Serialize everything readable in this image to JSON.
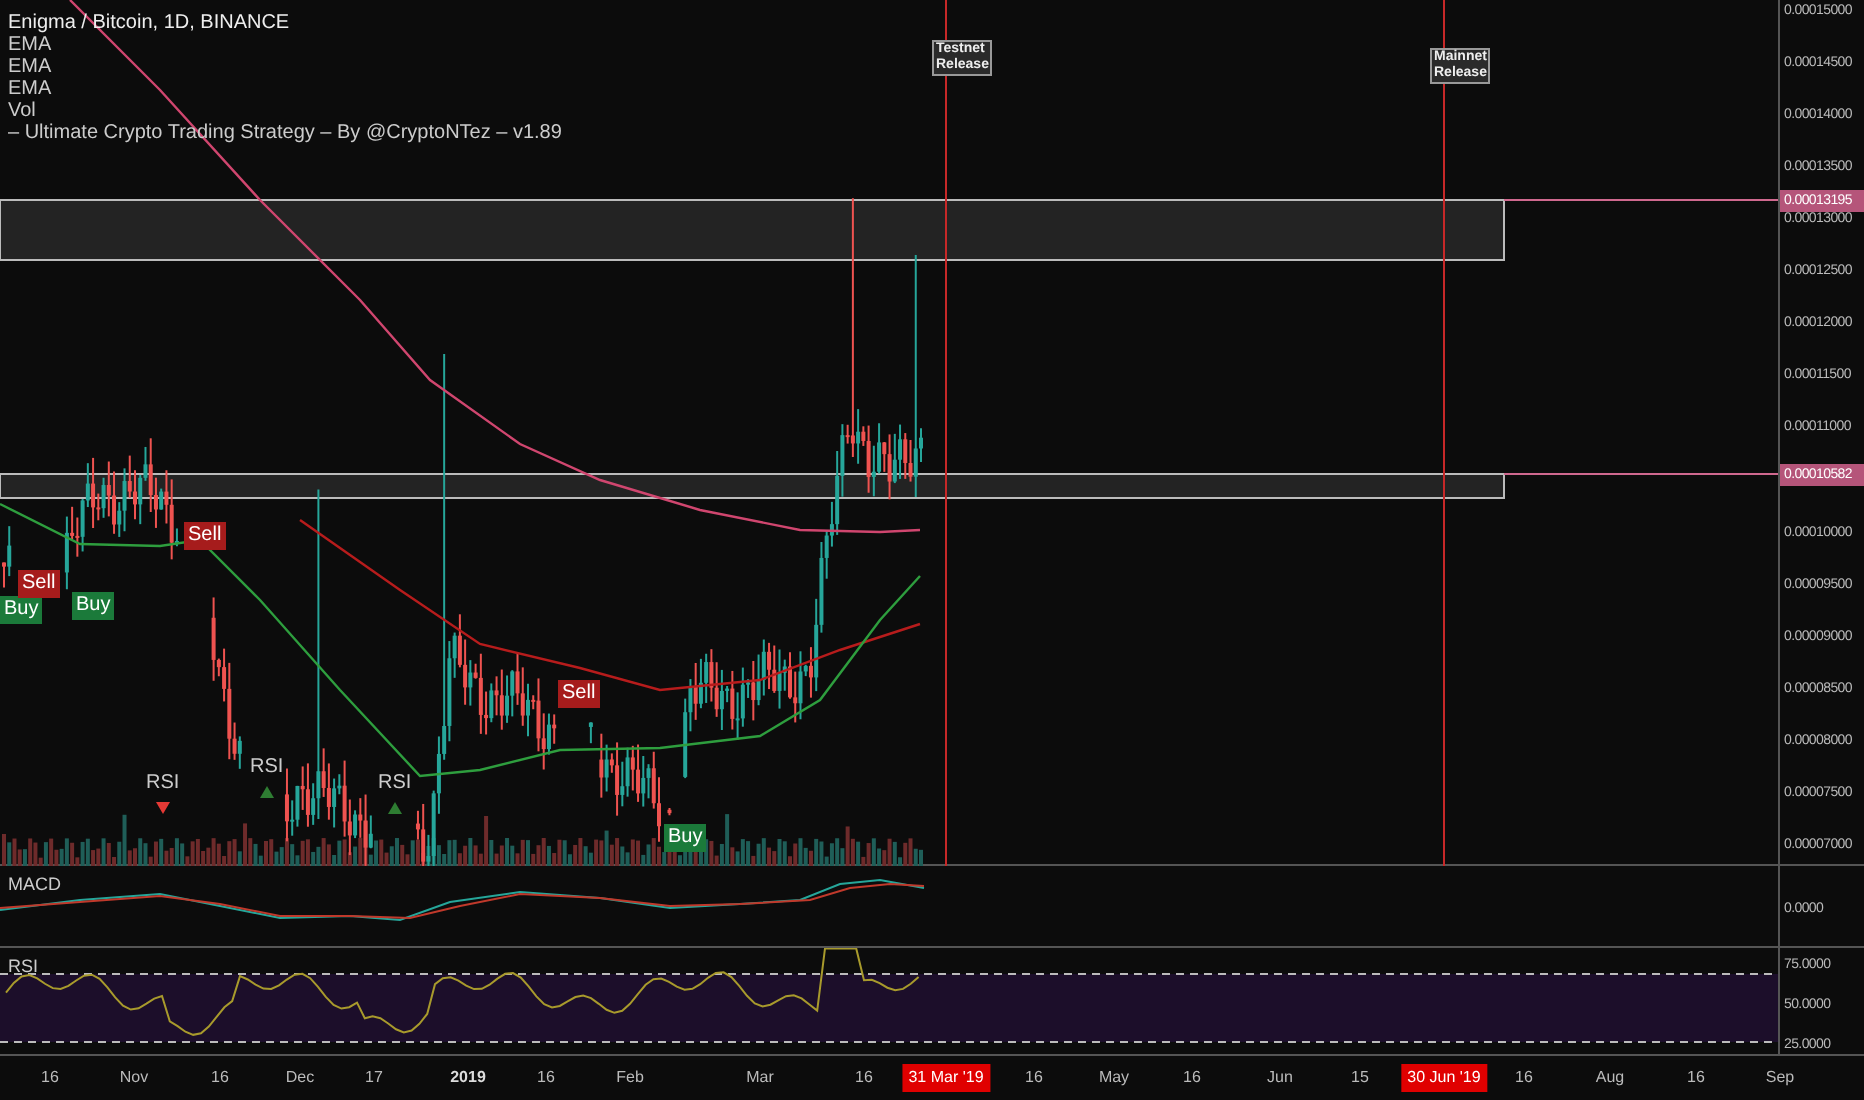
{
  "legend": {
    "title": "Enigma / Bitcoin, 1D, BINANCE",
    "indicators": [
      "EMA",
      "EMA",
      "EMA",
      "Vol",
      "– Ultimate Crypto Trading Strategy – By @CryptoNTez – v1.89"
    ]
  },
  "price_axis": {
    "ticks": [
      "0.00015000",
      "0.00014500",
      "0.00014000",
      "0.00013500",
      "0.00013000",
      "0.00012500",
      "0.00012000",
      "0.00011500",
      "0.00011000",
      "0.00010000",
      "0.00009500",
      "0.00009000",
      "0.00008500",
      "0.00008000",
      "0.00007500",
      "0.00007000"
    ],
    "marked": [
      {
        "label": "0.00013195"
      },
      {
        "label": "0.00010582"
      }
    ]
  },
  "events": [
    {
      "label": "Testnet Release"
    },
    {
      "label": "Mainnet Release"
    }
  ],
  "signals": [
    {
      "kind": "buy",
      "label": "Buy"
    },
    {
      "kind": "sell",
      "label": "Sell"
    },
    {
      "kind": "buy",
      "label": "Buy"
    },
    {
      "kind": "sell",
      "label": "Sell"
    },
    {
      "kind": "sell",
      "label": "Sell"
    },
    {
      "kind": "buy",
      "label": "Buy"
    },
    {
      "kind": "rsi_down",
      "label": "RSI"
    },
    {
      "kind": "rsi_up",
      "label": "RSI"
    },
    {
      "kind": "rsi_up",
      "label": "RSI"
    }
  ],
  "panes": [
    {
      "title": "MACD",
      "axis_labels": [
        "0.0000"
      ]
    },
    {
      "title": "RSI",
      "axis_labels": [
        "75.0000",
        "50.0000",
        "25.0000"
      ]
    }
  ],
  "time_axis": [
    {
      "kind": "tick",
      "label": "16"
    },
    {
      "kind": "tick",
      "label": "Nov"
    },
    {
      "kind": "tick",
      "label": "16"
    },
    {
      "kind": "tick",
      "label": "Dec"
    },
    {
      "kind": "tick",
      "label": "17"
    },
    {
      "kind": "year",
      "label": "2019"
    },
    {
      "kind": "tick",
      "label": "16"
    },
    {
      "kind": "tick",
      "label": "Feb"
    },
    {
      "kind": "tick",
      "label": "Mar"
    },
    {
      "kind": "tick",
      "label": "16"
    },
    {
      "kind": "event",
      "label": "31 Mar '19"
    },
    {
      "kind": "tick",
      "label": "16"
    },
    {
      "kind": "tick",
      "label": "May"
    },
    {
      "kind": "tick",
      "label": "16"
    },
    {
      "kind": "tick",
      "label": "Jun"
    },
    {
      "kind": "tick",
      "label": "15"
    },
    {
      "kind": "event",
      "label": "30 Jun '19"
    },
    {
      "kind": "tick",
      "label": "16"
    },
    {
      "kind": "tick",
      "label": "Aug"
    },
    {
      "kind": "tick",
      "label": "16"
    },
    {
      "kind": "tick",
      "label": "Sep"
    }
  ]
}
